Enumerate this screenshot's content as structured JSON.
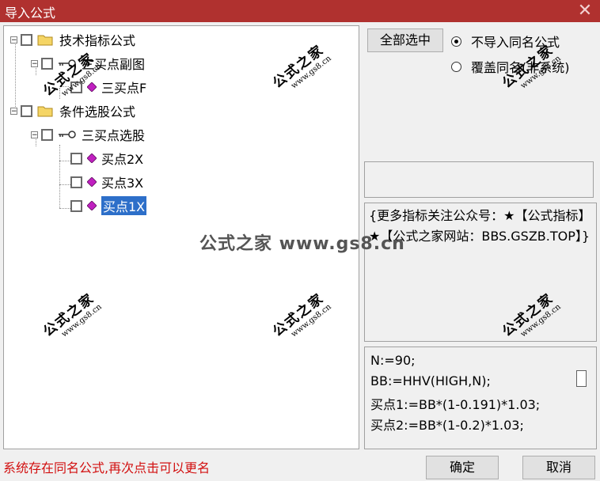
{
  "window": {
    "title": "导入公式",
    "close_glyph": "✕"
  },
  "tree": {
    "group1_label": "技术指标公式",
    "formula1_label": "三买点副图",
    "item1_label": "三买点F",
    "group2_label": "条件选股公式",
    "formula2_label": "三买点选股",
    "item2_label": "买点2X",
    "item3_label": "买点3X",
    "item4_label": "买点1X",
    "expander_glyph": "−"
  },
  "controls": {
    "select_all": "全部选中",
    "radio_skip": "不导入同名公式",
    "radio_overwrite": "覆盖同名(非系统)",
    "ok": "确定",
    "cancel": "取消"
  },
  "description": "{更多指标关注公众号：★【公式指标】★【公式之家网站：BBS.GSZB.TOP】}",
  "code_lines": [
    "N:=90;",
    "BB:=HHV(HIGH,N);",
    "买点1:=BB*(1-0.191)*1.03;",
    "买点2:=BB*(1-0.2)*1.03;"
  ],
  "status_text": "系统存在同名公式,再次点击可以更名",
  "watermark": {
    "main": "公式之家",
    "url": "www.gs8.cn",
    "center": "公式之家 www.gs8.cn"
  },
  "colors": {
    "title_bar": "#b0312f",
    "selection": "#2d6fc9",
    "status": "#d21010",
    "gem": "#c020c0"
  }
}
